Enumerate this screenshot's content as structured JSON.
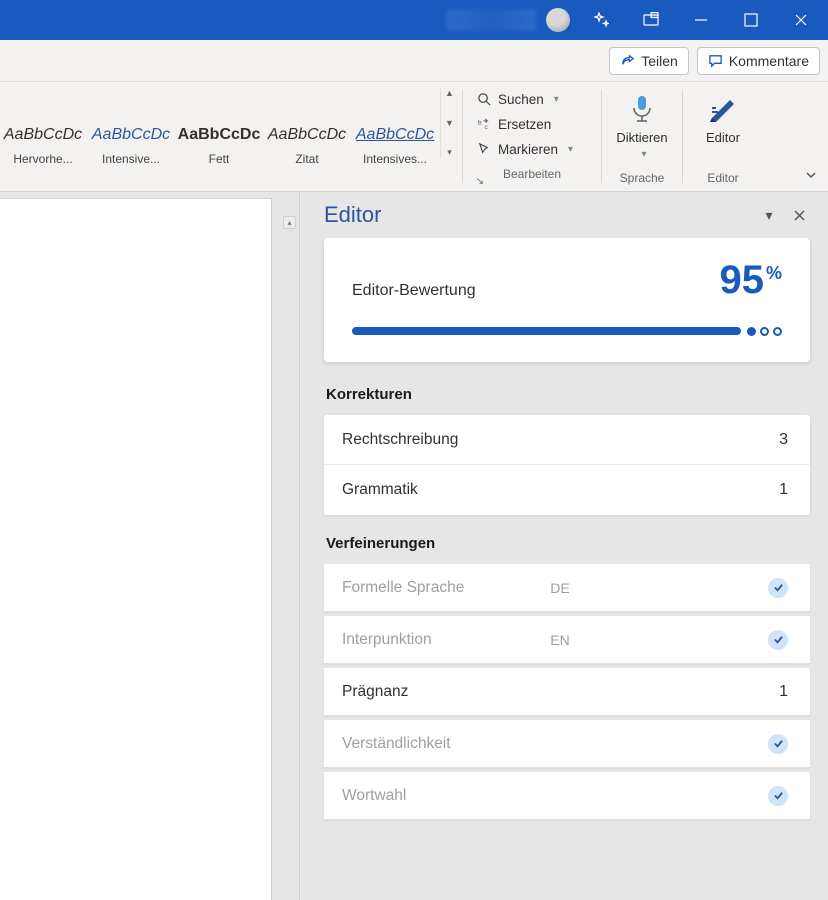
{
  "titlebar": {
    "icons": [
      "sparkle",
      "restore-overlay",
      "minimize",
      "maximize",
      "close"
    ]
  },
  "header": {
    "share_label": "Teilen",
    "comments_label": "Kommentare"
  },
  "ribbon": {
    "styles": [
      {
        "sample": "AaBbCcDc",
        "label": "Hervorhe...",
        "variant": "italic"
      },
      {
        "sample": "AaBbCcDc",
        "label": "Intensive...",
        "variant": "blue"
      },
      {
        "sample": "AaBbCcDc",
        "label": "Fett",
        "variant": "bold"
      },
      {
        "sample": "AaBbCcDc",
        "label": "Zitat",
        "variant": "italic"
      },
      {
        "sample": "AaBbCcDc",
        "label": "Intensives...",
        "variant": "underline"
      }
    ],
    "edit": {
      "search": "Suchen",
      "replace": "Ersetzen",
      "select": "Markieren",
      "group": "Bearbeiten"
    },
    "dictate": {
      "label": "Diktieren",
      "group": "Sprache"
    },
    "editor": {
      "label": "Editor",
      "group": "Editor"
    }
  },
  "editor_pane": {
    "title": "Editor",
    "score_label": "Editor-Bewertung",
    "score_value": "95",
    "score_unit": "%",
    "corrections_title": "Korrekturen",
    "corrections": [
      {
        "label": "Rechtschreibung",
        "count": "3"
      },
      {
        "label": "Grammatik",
        "count": "1"
      }
    ],
    "refinements_title": "Verfeinerungen",
    "refinements": [
      {
        "label": "Formelle Sprache",
        "tag": "DE",
        "ok": true,
        "muted": true
      },
      {
        "label": "Interpunktion",
        "tag": "EN",
        "ok": true,
        "muted": true
      },
      {
        "label": "Prägnanz",
        "count": "1",
        "ok": false,
        "muted": false
      },
      {
        "label": "Verständlichkeit",
        "ok": true,
        "muted": true
      },
      {
        "label": "Wortwahl",
        "ok": true,
        "muted": true
      }
    ]
  }
}
